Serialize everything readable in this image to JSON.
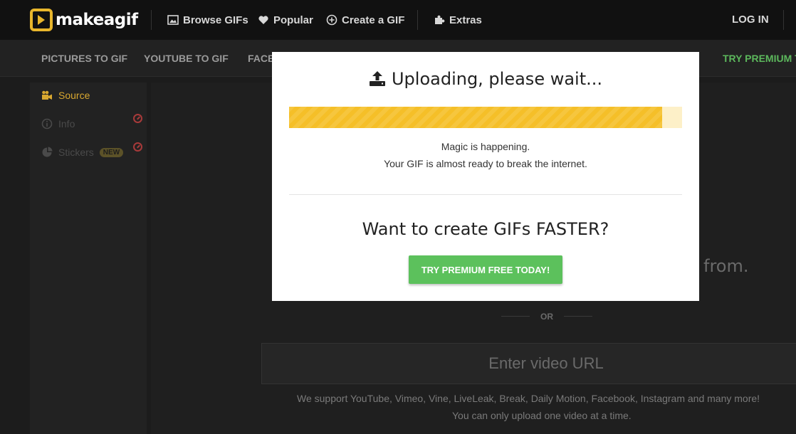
{
  "brand": {
    "name": "makeagif"
  },
  "topnav": {
    "items": [
      {
        "label": "Browse GIFs",
        "icon": "image-icon"
      },
      {
        "label": "Popular",
        "icon": "heart-icon"
      },
      {
        "label": "Create a GIF",
        "icon": "plus-circle-icon"
      },
      {
        "label": "Extras",
        "icon": "puzzle-icon"
      }
    ],
    "login_label": "LOG IN"
  },
  "subnav": {
    "items": [
      "PICTURES TO GIF",
      "YOUTUBE TO GIF",
      "FACE"
    ],
    "premium_label": "TRY PREMIUM T"
  },
  "sidebar": {
    "items": [
      {
        "label": "Source",
        "icon": "video-camera-icon",
        "active": true
      },
      {
        "label": "Info",
        "icon": "info-icon",
        "disabled": true
      },
      {
        "label": "Stickers",
        "icon": "sticker-icon",
        "badge": "NEW",
        "disabled": true
      }
    ]
  },
  "main": {
    "partial_text": "from.",
    "or_label": "OR",
    "url_placeholder": "Enter video URL",
    "support_line1": "We support YouTube, Vimeo, Vine, LiveLeak, Break, Daily Motion, Facebook, Instagram and many more!",
    "support_line2": "You can only upload one video at a time."
  },
  "modal": {
    "title": "Uploading, please wait...",
    "progress_fraction": 0.95,
    "message_line1": "Magic is happening.",
    "message_line2": "Your GIF is almost ready to break the internet.",
    "promo_title": "Want to create GIFs FASTER?",
    "promo_button": "TRY PREMIUM FREE TODAY!"
  },
  "colors": {
    "accent": "#e8b62c",
    "premium_green": "#5cc15c",
    "progress_fill": "#f5bf28",
    "progress_track": "#fdf0c8"
  }
}
